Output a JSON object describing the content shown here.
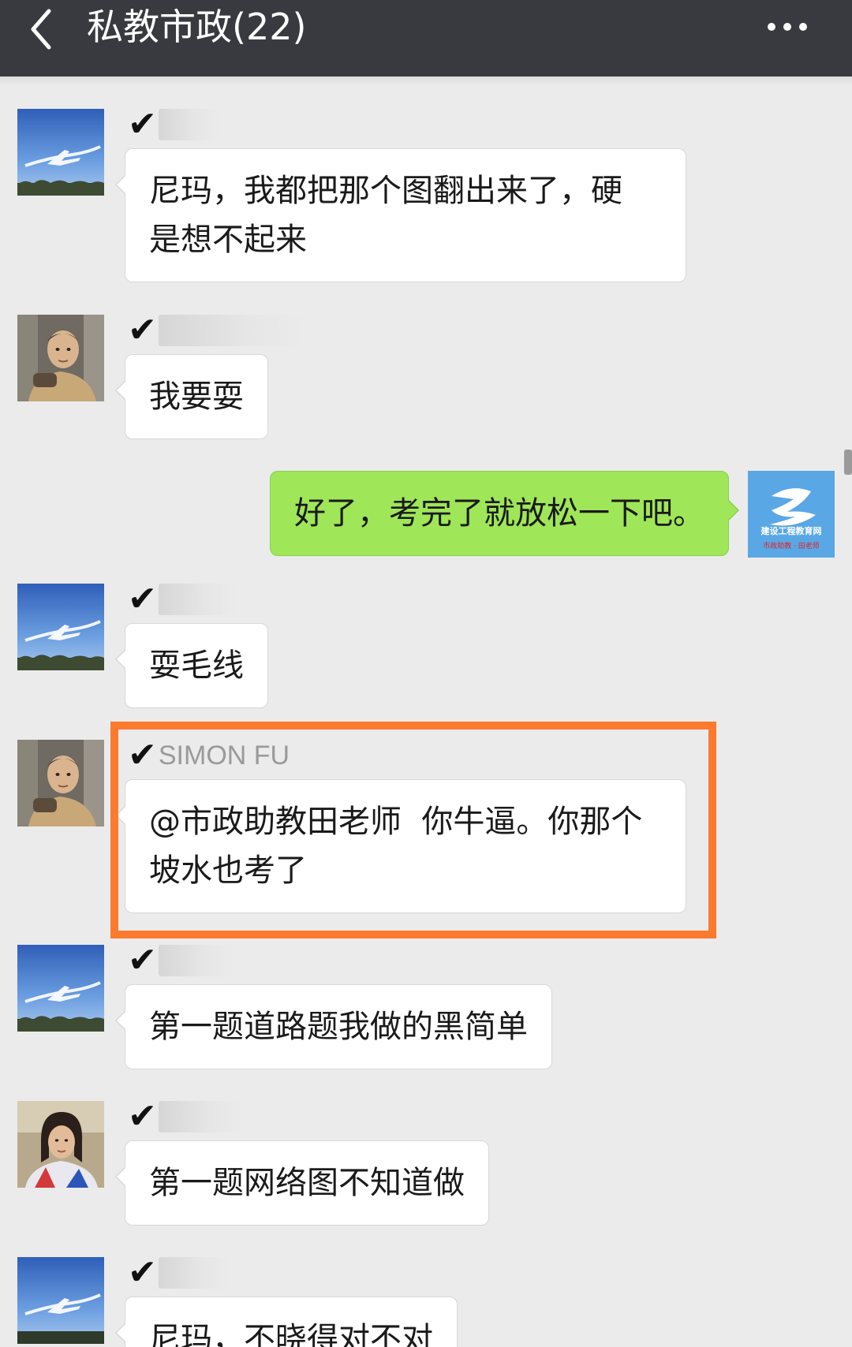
{
  "header": {
    "title": "私教市政(22)",
    "back_icon": "chevron-left-icon",
    "menu_icon": "more-dots-icon"
  },
  "colors": {
    "header_bg": "#393a3f",
    "chat_bg": "#ebebeb",
    "incoming_bubble": "#ffffff",
    "outgoing_bubble": "#9fe658",
    "highlight": "#fb7a2e"
  },
  "messages": [
    {
      "sender_mark": "✔",
      "nickname": "",
      "avatar": "sky-plane-avatar",
      "direction": "in",
      "text_lines": [
        "尼玛，我都把那个图翻出来了，硬",
        "是想不起来"
      ]
    },
    {
      "sender_mark": "✔",
      "nickname": "",
      "avatar": "man-portrait-avatar",
      "direction": "in",
      "text_lines": [
        "我要耍"
      ]
    },
    {
      "sender_mark": "",
      "nickname": "",
      "avatar": "jianshe-logo-avatar",
      "direction": "out",
      "text_lines": [
        "好了，考完了就放松一下吧。"
      ]
    },
    {
      "sender_mark": "✔",
      "nickname": "",
      "avatar": "sky-plane-avatar",
      "direction": "in",
      "text_lines": [
        "耍毛线"
      ]
    },
    {
      "sender_mark": "✔",
      "nickname": "SIMON FU",
      "avatar": "man-portrait-avatar",
      "direction": "in",
      "highlighted": true,
      "text_lines": [
        "@市政助教田老师  你牛逼。你那个",
        "坡水也考了"
      ]
    },
    {
      "sender_mark": "✔",
      "nickname": "",
      "avatar": "sky-plane-avatar",
      "direction": "in",
      "text_lines": [
        "第一题道路题我做的黑简单"
      ]
    },
    {
      "sender_mark": "✔",
      "nickname": "",
      "avatar": "woman-portrait-avatar",
      "direction": "in",
      "text_lines": [
        "第一题网络图不知道做"
      ]
    },
    {
      "sender_mark": "✔",
      "nickname": "",
      "avatar": "sky-plane-avatar",
      "direction": "in",
      "text_lines": [
        "尼玛，不晓得对不对"
      ]
    }
  ],
  "logo_avatar": {
    "brand_name": "建设工程教育网",
    "tagline": "市政助教 · 田老师"
  }
}
